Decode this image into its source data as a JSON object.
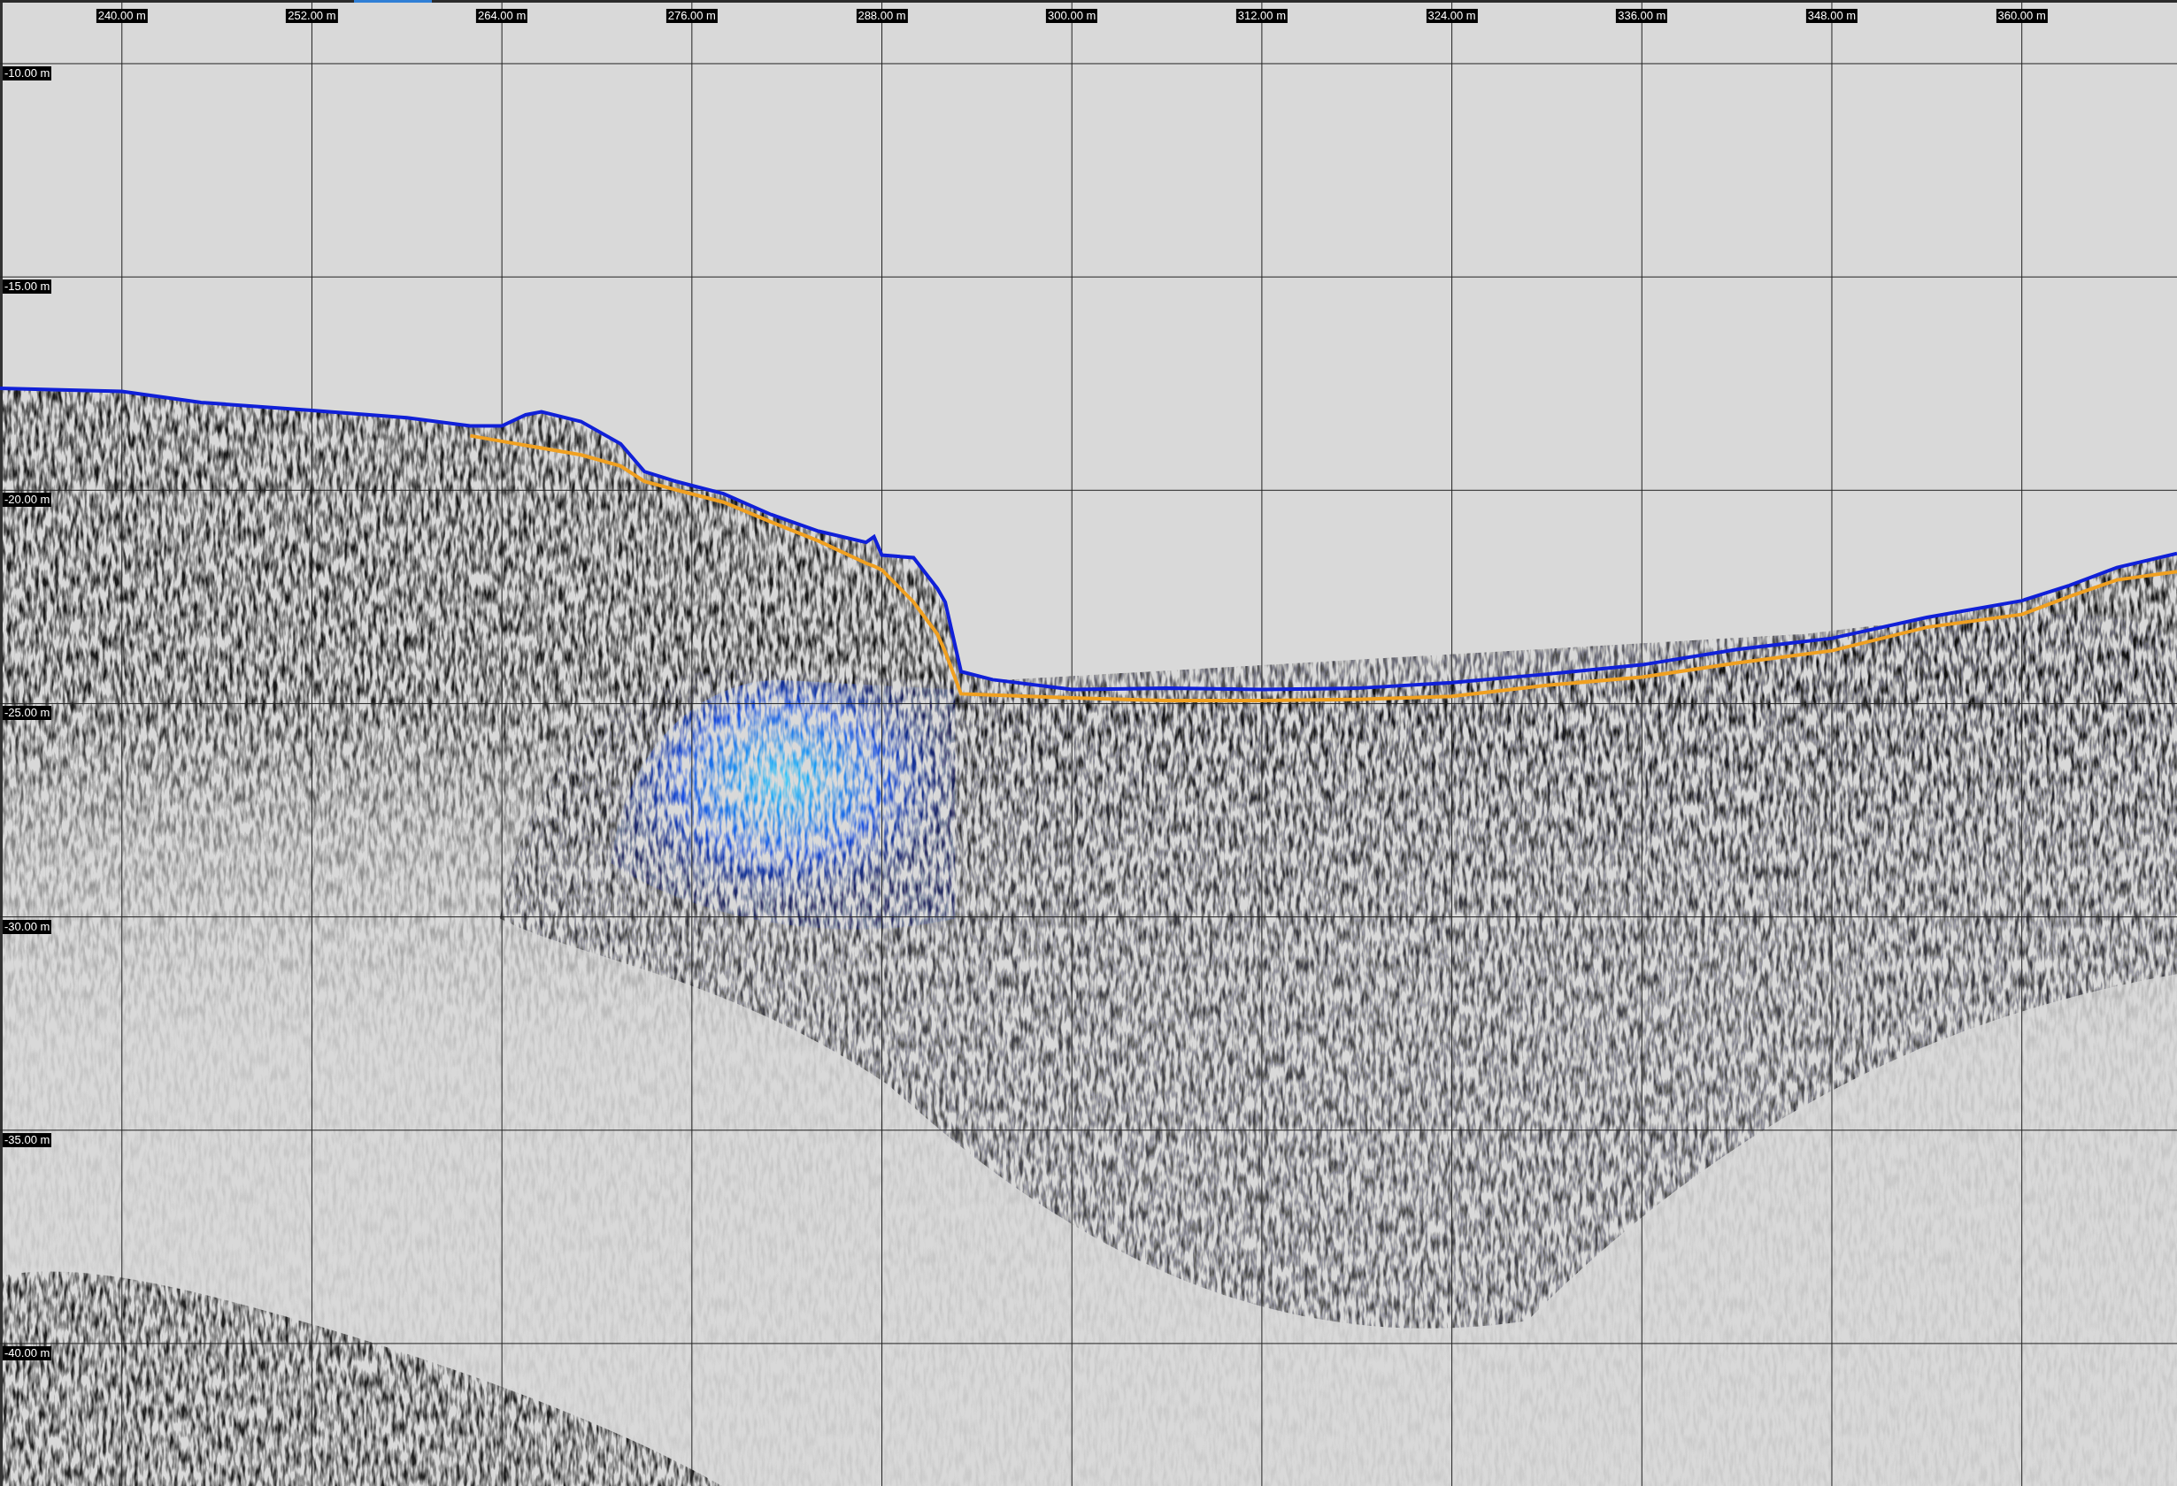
{
  "chart_data": {
    "type": "line",
    "grid": true,
    "xlim": [
      232.3,
      369.8
    ],
    "ylim": [
      -43.34,
      -8.57
    ],
    "xticks": [
      {
        "value": 240,
        "label": "240.00 m"
      },
      {
        "value": 252,
        "label": "252.00 m"
      },
      {
        "value": 264,
        "label": "264.00 m"
      },
      {
        "value": 276,
        "label": "276.00 m"
      },
      {
        "value": 288,
        "label": "288.00 m"
      },
      {
        "value": 300,
        "label": "300.00 m"
      },
      {
        "value": 312,
        "label": "312.00 m"
      },
      {
        "value": 324,
        "label": "324.00 m"
      },
      {
        "value": 336,
        "label": "336.00 m"
      },
      {
        "value": 348,
        "label": "348.00 m"
      },
      {
        "value": 360,
        "label": "360.00 m"
      }
    ],
    "yticks": [
      {
        "value": -10,
        "label": "-10.00 m"
      },
      {
        "value": -15,
        "label": "-15.00 m"
      },
      {
        "value": -20,
        "label": "-20.00 m"
      },
      {
        "value": -25,
        "label": "-25.00 m"
      },
      {
        "value": -30,
        "label": "-30.00 m"
      },
      {
        "value": -35,
        "label": "-35.00 m"
      },
      {
        "value": -40,
        "label": "-40.00 m"
      }
    ],
    "x": [
      232.3,
      240,
      245,
      252,
      258,
      262,
      264,
      265.5,
      266.5,
      269,
      271.5,
      273,
      275,
      278,
      281,
      284,
      287,
      287.5,
      288,
      290,
      291.5,
      292,
      293,
      295,
      300,
      306,
      312,
      318,
      324,
      330,
      336,
      342,
      348,
      354,
      360,
      363,
      366,
      369.8
    ],
    "series": [
      {
        "color": "#1020d8",
        "values": [
          -17.61,
          -17.68,
          -17.94,
          -18.13,
          -18.3,
          -18.49,
          -18.49,
          -18.23,
          -18.16,
          -18.39,
          -18.91,
          -19.56,
          -19.79,
          -20.08,
          -20.57,
          -20.96,
          -21.22,
          -21.09,
          -21.52,
          -21.58,
          -22.3,
          -22.62,
          -24.25,
          -24.44,
          -24.67,
          -24.64,
          -24.67,
          -24.64,
          -24.51,
          -24.31,
          -24.09,
          -23.73,
          -23.47,
          -22.98,
          -22.59,
          -22.23,
          -21.81,
          -21.48
        ]
      },
      {
        "color": "#f0a020",
        "values": [
          null,
          null,
          null,
          null,
          null,
          -18.72,
          -18.85,
          -18.95,
          -19.01,
          -19.17,
          -19.43,
          -19.79,
          -19.99,
          -20.28,
          -20.74,
          -21.19,
          -21.71,
          -21.78,
          -21.87,
          -22.62,
          -23.37,
          -23.79,
          -24.77,
          -24.8,
          -24.87,
          -24.93,
          -24.93,
          -24.9,
          -24.83,
          -24.57,
          -24.38,
          -24.05,
          -23.76,
          -23.21,
          -22.91,
          -22.49,
          -22.1,
          -21.91
        ]
      }
    ]
  }
}
